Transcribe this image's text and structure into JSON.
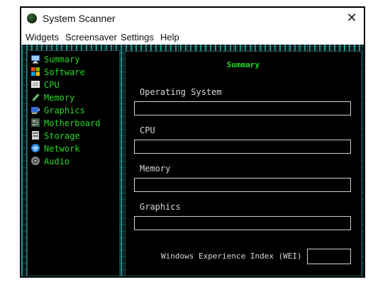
{
  "window": {
    "title": "System Scanner",
    "close_glyph": "✕"
  },
  "menu": [
    "Widgets",
    "Screensaver",
    "Settings",
    "Help"
  ],
  "sidebar": {
    "items": [
      {
        "label": "Summary",
        "icon": "summary-icon"
      },
      {
        "label": "Software",
        "icon": "windows-logo-icon"
      },
      {
        "label": "CPU",
        "icon": "cpu-icon"
      },
      {
        "label": "Memory",
        "icon": "memory-stick-icon"
      },
      {
        "label": "Graphics",
        "icon": "graphics-card-icon"
      },
      {
        "label": "Motherboard",
        "icon": "motherboard-icon"
      },
      {
        "label": "Storage",
        "icon": "storage-drive-icon"
      },
      {
        "label": "Network",
        "icon": "network-icon"
      },
      {
        "label": "Audio",
        "icon": "audio-speaker-icon"
      }
    ]
  },
  "main": {
    "title": "Summary",
    "fields": [
      {
        "label": "Operating System",
        "value": ""
      },
      {
        "label": "CPU",
        "value": ""
      },
      {
        "label": "Memory",
        "value": ""
      },
      {
        "label": "Graphics",
        "value": ""
      }
    ],
    "wei_label": "Windows Experience Index (WEI)",
    "wei_value": ""
  },
  "colors": {
    "accent_green": "#27d827",
    "circuit_cyan": "#3ce6e6",
    "panel_bg": "#000000"
  }
}
